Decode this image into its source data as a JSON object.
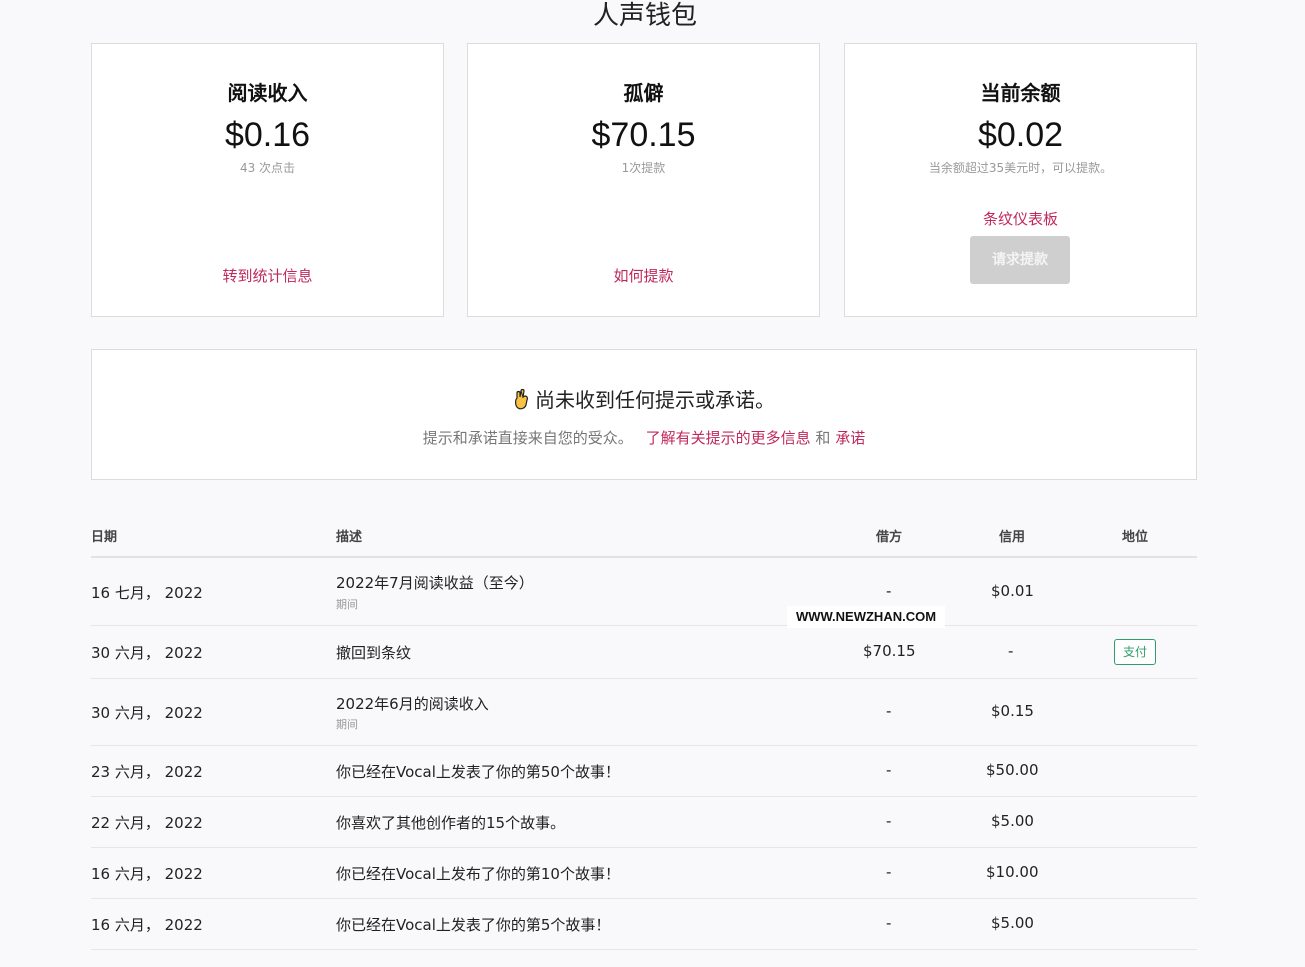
{
  "page": {
    "title": "人声钱包"
  },
  "cards": [
    {
      "title": "阅读收入",
      "amount": "$0.16",
      "sub": "43 次点击",
      "link": "转到统计信息"
    },
    {
      "title": "孤僻",
      "amount": "$70.15",
      "sub": "1次提款",
      "link": "如何提款"
    },
    {
      "title": "当前余额",
      "amount": "$0.02",
      "sub": "当余额超过35美元时，可以提款。",
      "link": "条纹仪表板",
      "button": "请求提款"
    }
  ],
  "tips": {
    "icon": "crossed-fingers-icon",
    "heading": "尚未收到任何提示或承诺。",
    "body": "提示和承诺直接来自您的受众。",
    "link1": "了解有关提示的更多信息",
    "and": "和",
    "link2": "承诺"
  },
  "table": {
    "headers": {
      "date": "日期",
      "desc": "描述",
      "debit": "借方",
      "credit": "信用",
      "status": "地位"
    },
    "rows": [
      {
        "date": "16 七月， 2022",
        "desc": "2022年7月阅读收益（至今）",
        "sub": "期间",
        "debit": "-",
        "credit": "$0.01",
        "status": ""
      },
      {
        "date": "30 六月， 2022",
        "desc": "撤回到条纹",
        "sub": "",
        "debit": "$70.15",
        "credit": "-",
        "status": "支付"
      },
      {
        "date": "30 六月， 2022",
        "desc": "2022年6月的阅读收入",
        "sub": "期间",
        "debit": "-",
        "credit": "$0.15",
        "status": ""
      },
      {
        "date": "23 六月， 2022",
        "desc": "你已经在Vocal上发表了你的第50个故事！",
        "sub": "",
        "debit": "-",
        "credit": "$50.00",
        "status": ""
      },
      {
        "date": "22 六月， 2022",
        "desc": "你喜欢了其他创作者的15个故事。",
        "sub": "",
        "debit": "-",
        "credit": "$5.00",
        "status": ""
      },
      {
        "date": "16 六月， 2022",
        "desc": "你已经在Vocal上发布了你的第10个故事！",
        "sub": "",
        "debit": "-",
        "credit": "$10.00",
        "status": ""
      },
      {
        "date": "16 六月， 2022",
        "desc": "你已经在Vocal上发表了你的第5个故事！",
        "sub": "",
        "debit": "-",
        "credit": "$5.00",
        "status": ""
      }
    ]
  },
  "watermark": "WWW.NEWZHAN.COM",
  "colors": {
    "accent": "#c0285c",
    "success": "#2f9e6a",
    "border": "#dcdcdc"
  }
}
